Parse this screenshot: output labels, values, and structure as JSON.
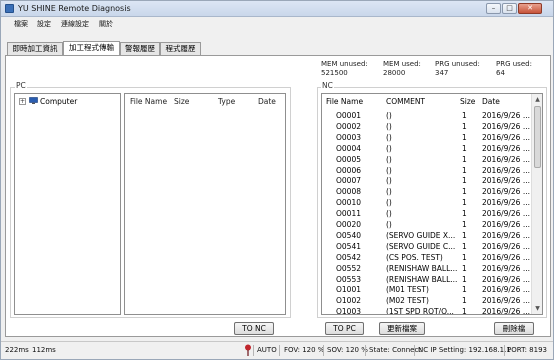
{
  "window": {
    "title": "YU SHINE Remote Diagnosis",
    "icon": "app-icon"
  },
  "menu": [
    "檔案",
    "設定",
    "連線設定",
    "關於"
  ],
  "tabs": [
    {
      "label": "即時加工資訊",
      "active": false
    },
    {
      "label": "加工程式傳輸",
      "active": true
    },
    {
      "label": "警報履歷",
      "active": false
    },
    {
      "label": "程式履歷",
      "active": false
    }
  ],
  "mem": {
    "unused_label": "MEM unused:",
    "unused_value": "521500",
    "used_label": "MEM used:",
    "used_value": "28000",
    "prg_unused_label": "PRG unused:",
    "prg_unused_value": "347",
    "prg_used_label": "PRG used:",
    "prg_used_value": "64"
  },
  "pc": {
    "group_label": "PC",
    "tree": [
      {
        "label": "Computer",
        "icon": "computer-icon",
        "expander": "+"
      }
    ],
    "columns": [
      "File Name",
      "Size",
      "Type",
      "Date"
    ]
  },
  "nc": {
    "group_label": "NC",
    "columns": [
      "File Name",
      "COMMENT",
      "Size",
      "Date"
    ],
    "rows": [
      {
        "name": "O0001",
        "comment": "()",
        "size": "1",
        "date": "2016/9/26 ..."
      },
      {
        "name": "O0002",
        "comment": "()",
        "size": "1",
        "date": "2016/9/26 ..."
      },
      {
        "name": "O0003",
        "comment": "()",
        "size": "1",
        "date": "2016/9/26 ..."
      },
      {
        "name": "O0004",
        "comment": "()",
        "size": "1",
        "date": "2016/9/26 ..."
      },
      {
        "name": "O0005",
        "comment": "()",
        "size": "1",
        "date": "2016/9/26 ..."
      },
      {
        "name": "O0006",
        "comment": "()",
        "size": "1",
        "date": "2016/9/26 ..."
      },
      {
        "name": "O0007",
        "comment": "()",
        "size": "1",
        "date": "2016/9/26 ..."
      },
      {
        "name": "O0008",
        "comment": "()",
        "size": "1",
        "date": "2016/9/26 ..."
      },
      {
        "name": "O0010",
        "comment": "()",
        "size": "1",
        "date": "2016/9/26 ..."
      },
      {
        "name": "O0011",
        "comment": "()",
        "size": "1",
        "date": "2016/9/26 ..."
      },
      {
        "name": "O0020",
        "comment": "()",
        "size": "1",
        "date": "2016/9/26 ..."
      },
      {
        "name": "O0540",
        "comment": "(SERVO GUIDE X...",
        "size": "1",
        "date": "2016/9/26 ..."
      },
      {
        "name": "O0541",
        "comment": "(SERVO GUIDE C...",
        "size": "1",
        "date": "2016/9/26 ..."
      },
      {
        "name": "O0542",
        "comment": "(CS POS. TEST)",
        "size": "1",
        "date": "2016/9/26 ..."
      },
      {
        "name": "O0552",
        "comment": "(RENISHAW BALL...",
        "size": "1",
        "date": "2016/9/26 ..."
      },
      {
        "name": "O0553",
        "comment": "(RENISHAW BALL...",
        "size": "1",
        "date": "2016/9/26 ..."
      },
      {
        "name": "O1001",
        "comment": "(M01 TEST)",
        "size": "1",
        "date": "2016/9/26 ..."
      },
      {
        "name": "O1002",
        "comment": "(M02 TEST)",
        "size": "1",
        "date": "2016/9/26 ..."
      },
      {
        "name": "O1003",
        "comment": "(1ST SPD ROT/O...",
        "size": "1",
        "date": "2016/9/26 ..."
      }
    ]
  },
  "buttons": {
    "to_nc": "TO NC",
    "to_pc": "TO PC",
    "refresh": "更新檔案",
    "delete": "刪除檔"
  },
  "status": {
    "timing1": "222ms",
    "timing2": "112ms",
    "mode": "AUTO",
    "fov": "FOV: 120 %",
    "sov": "SOV: 120 %",
    "state": "State: Connect",
    "ip": "NC IP Setting: 192.168.1.1",
    "port": "PORT: 8193"
  },
  "colors": {
    "title_bg": "#c9d7ea",
    "close_btn": "#c75339",
    "pin": "#c0262d",
    "tree_icon": "#2a5db0"
  }
}
